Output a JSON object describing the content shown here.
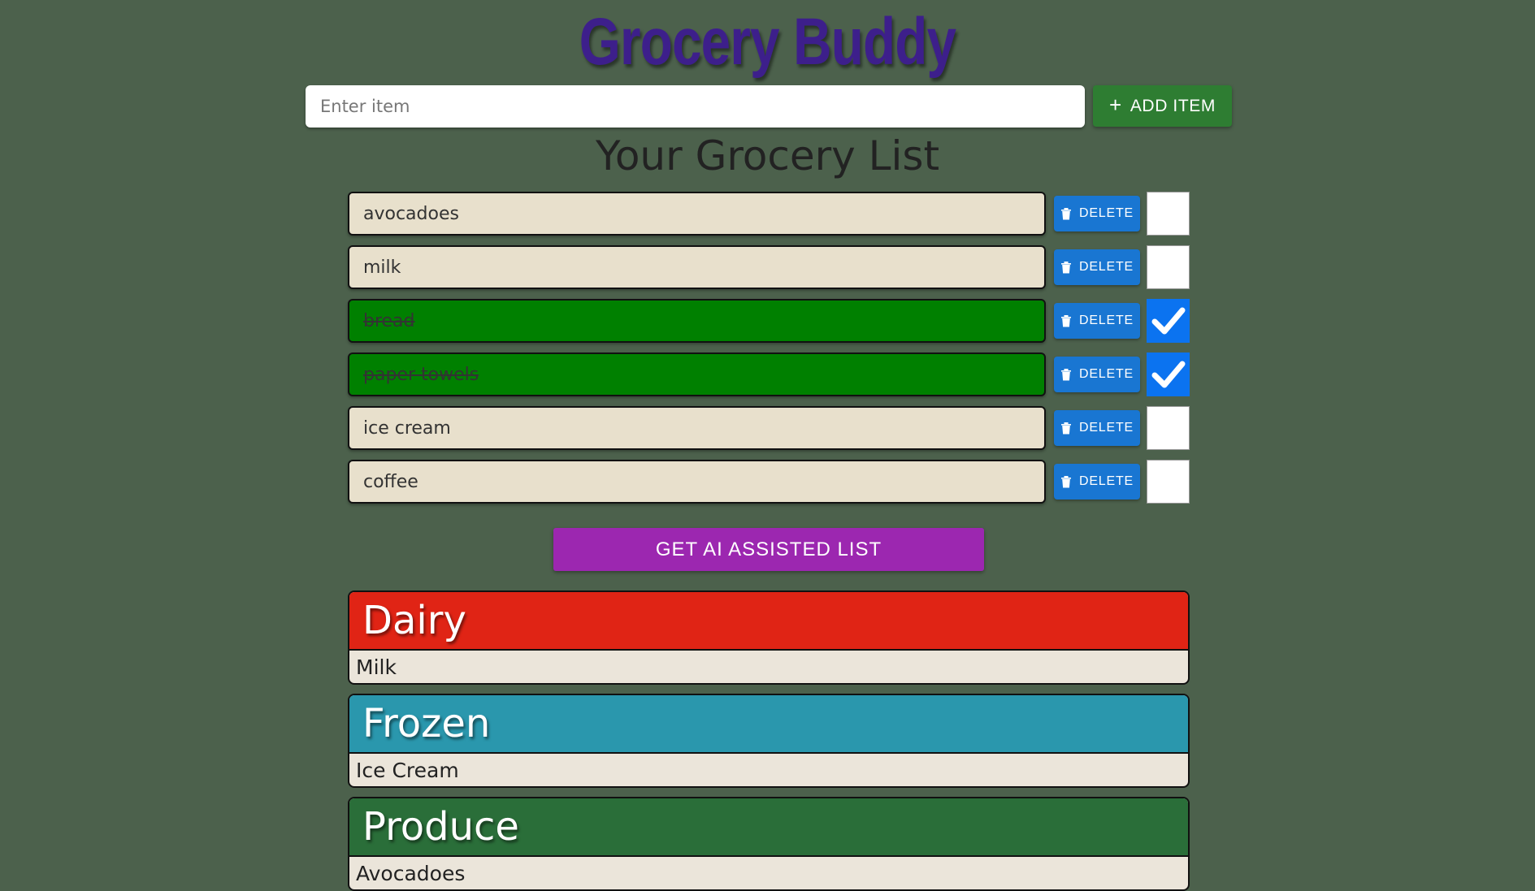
{
  "app": {
    "title": "Grocery Buddy"
  },
  "add": {
    "placeholder": "Enter item",
    "button_label": "ADD ITEM",
    "button_icon": "plus-icon"
  },
  "list": {
    "heading": "Your Grocery List",
    "delete_label": "DELETE",
    "items": [
      {
        "name": "avocadoes",
        "checked": false
      },
      {
        "name": "milk",
        "checked": false
      },
      {
        "name": "bread",
        "checked": true
      },
      {
        "name": "paper towels",
        "checked": true
      },
      {
        "name": "ice cream",
        "checked": false
      },
      {
        "name": "coffee",
        "checked": false
      }
    ]
  },
  "ai": {
    "button_label": "GET AI ASSISTED LIST"
  },
  "categories": [
    {
      "name": "Dairy",
      "color": "#e02415",
      "items": [
        "Milk"
      ]
    },
    {
      "name": "Frozen",
      "color": "#2a97ad",
      "items": [
        "Ice Cream"
      ]
    },
    {
      "name": "Produce",
      "color": "#2a6e39",
      "items": [
        "Avocadoes"
      ]
    }
  ],
  "colors": {
    "background": "#4c614c",
    "title": "#3d1f8b",
    "add_button": "#2e7d32",
    "delete_button": "#1976d2",
    "ai_button": "#9c27b0",
    "item_unchecked": "#e8e0cc",
    "item_checked": "#008000",
    "checkbox_checked": "#0b73f0"
  }
}
